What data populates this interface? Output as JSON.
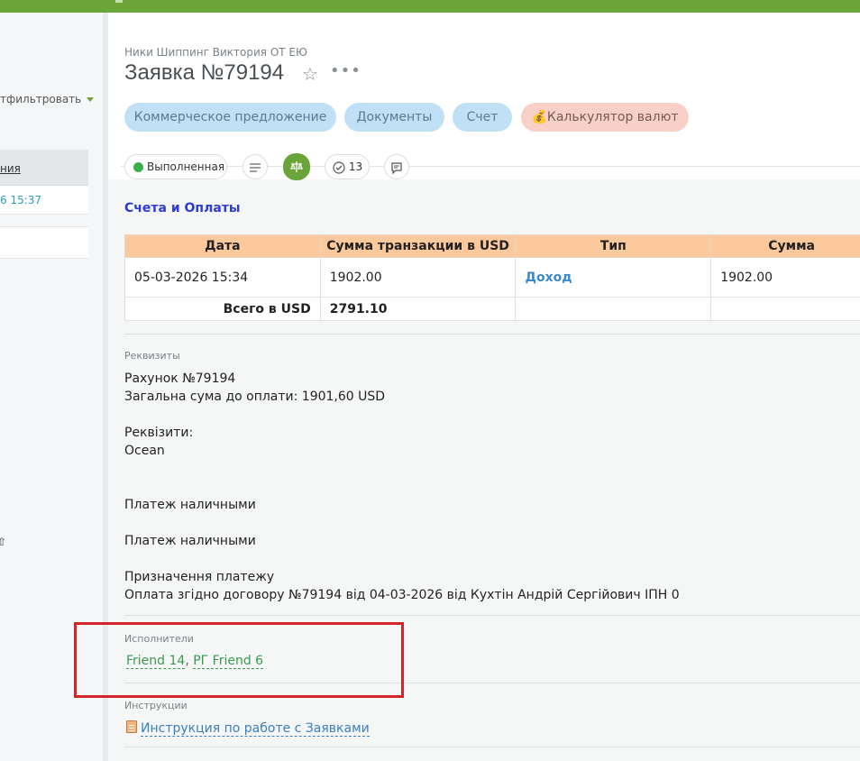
{
  "left_panel": {
    "filter_label": "тфильтровать",
    "column_header": "ния",
    "row_time": "6 15:37"
  },
  "header": {
    "breadcrumb": "Ники Шиппинг Виктория ОТ ЕЮ",
    "title": "Заявка №79194"
  },
  "actions": {
    "commercial_offer": "Коммерческое предложение",
    "documents": "Документы",
    "invoice": "Счет",
    "currency_calc": "💰Калькулятор валют"
  },
  "status_bar": {
    "status": "Выполненная",
    "checklist_count": "13"
  },
  "payments": {
    "section_title": "Счета и Оплаты",
    "columns": [
      "Дата",
      "Сумма транзакции в USD",
      "Тип",
      "Сумма"
    ],
    "rows": [
      [
        "05-03-2026 15:34",
        "1902.00",
        "Доход",
        "1902.00"
      ]
    ],
    "total_label": "Всего в USD",
    "total_value": "2791.10"
  },
  "requisites": {
    "label": "Реквизиты",
    "text": "Рахунок №79194\nЗагальна сума до оплати: 1901,60 USD\n\nРеквізити:\nOcean\n\n\nПлатеж наличными\n\nПлатеж наличными\n\nПризначення платежу\nОплата згідно договору №79194 від 04-03-2026 від Кухтін Андрій Сергійович ІПН 0"
  },
  "executors": {
    "label": "Исполнители",
    "people": [
      "Friend 14",
      "РГ Friend 6"
    ],
    "separator": ", "
  },
  "instructions": {
    "label": "Инструкции",
    "link": "Инструкция по работе с Заявками"
  },
  "colors": {
    "brand_green": "#6ba539",
    "pill_blue": "#bfe0f5",
    "pill_pink": "#f8d0c7",
    "table_header": "#fbc99b",
    "highlight_red": "#d3262a"
  }
}
